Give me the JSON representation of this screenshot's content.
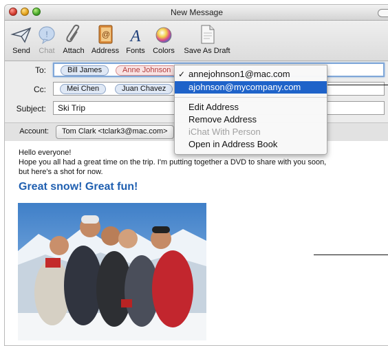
{
  "window": {
    "title": "New Message"
  },
  "toolbar": {
    "items": [
      {
        "label": "Send",
        "icon": "send-icon"
      },
      {
        "label": "Chat",
        "icon": "chat-icon",
        "disabled": true
      },
      {
        "label": "Attach",
        "icon": "paperclip-icon"
      },
      {
        "label": "Address",
        "icon": "address-book-icon"
      },
      {
        "label": "Fonts",
        "icon": "fonts-icon"
      },
      {
        "label": "Colors",
        "icon": "color-wheel-icon"
      },
      {
        "label": "Save As Draft",
        "icon": "draft-icon"
      }
    ]
  },
  "headers": {
    "to_label": "To:",
    "cc_label": "Cc:",
    "subject_label": "Subject:",
    "account_label": "Account:",
    "to": [
      "Bill James",
      "Anne Johnson"
    ],
    "cc": [
      "Mei Chen",
      "Juan Chavez"
    ],
    "subject": "Ski Trip",
    "account": "Tom Clark <tclark3@mac.com>"
  },
  "menu": {
    "addresses": [
      {
        "text": "annejohnson1@mac.com",
        "checked": true
      },
      {
        "text": "ajohnson@mycompany.com",
        "highlighted": true
      }
    ],
    "actions": [
      {
        "text": "Edit Address"
      },
      {
        "text": "Remove Address"
      },
      {
        "text": "iChat With Person",
        "disabled": true
      },
      {
        "text": "Open in Address Book"
      }
    ]
  },
  "message": {
    "line1": "Hello everyone!",
    "line2": "Hope you all had a great time on the trip. I'm putting together a DVD to share with you soon,",
    "line3": "but here's a shot for now.",
    "headline": "Great snow! Great fun!"
  },
  "colors": {
    "accent": "#1f63c9",
    "headline": "#1f5fb0",
    "selected_token": "#b23a3a"
  }
}
